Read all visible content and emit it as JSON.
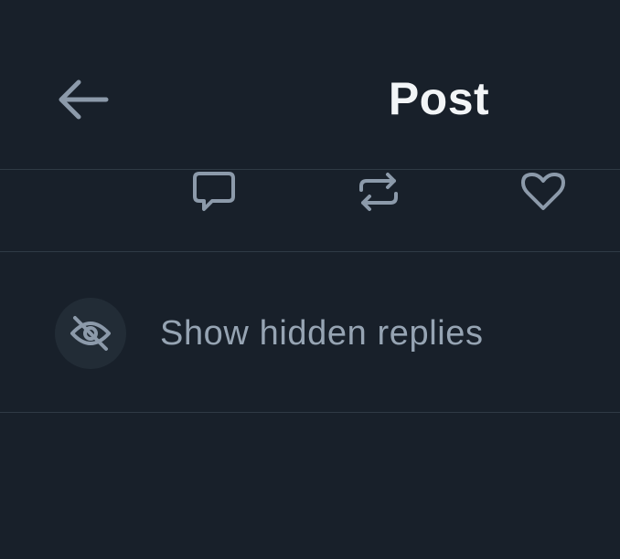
{
  "header": {
    "title": "Post",
    "back_icon": "arrow-left-icon"
  },
  "actions": {
    "reply_icon": "comment-icon",
    "repost_icon": "repost-icon",
    "like_icon": "heart-icon"
  },
  "hidden_replies": {
    "icon": "eye-slash-icon",
    "label": "Show hidden replies"
  },
  "colors": {
    "background": "#18202a",
    "divider": "#2f3a45",
    "title": "#f2f5f7",
    "icon": "#8c9aaa",
    "label": "#96a4b3",
    "icon_circle": "#222c36"
  }
}
